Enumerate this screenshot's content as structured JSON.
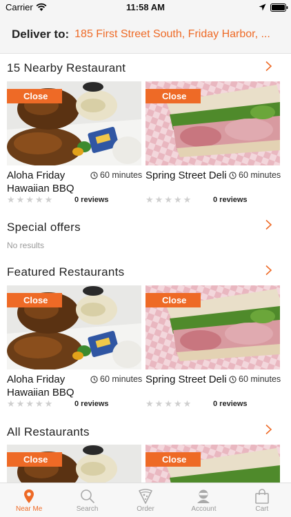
{
  "status_bar": {
    "carrier": "Carrier",
    "time": "11:58 AM"
  },
  "header": {
    "deliver_label": "Deliver to:",
    "address": "185 First Street South, Friday Harbor, ..."
  },
  "sections": {
    "nearby": {
      "title": "15 Nearby Restaurant",
      "cards": [
        {
          "badge": "Close",
          "name": "Aloha Friday Hawaiian BBQ",
          "time": "60 minutes",
          "reviews": "0 reviews"
        },
        {
          "badge": "Close",
          "name": "Spring Street Deli",
          "time": "60 minutes",
          "reviews": "0 reviews"
        }
      ]
    },
    "special": {
      "title": "Special offers",
      "empty_text": "No results"
    },
    "featured": {
      "title": "Featured Restaurants",
      "cards": [
        {
          "badge": "Close",
          "name": "Aloha Friday Hawaiian BBQ",
          "time": "60 minutes",
          "reviews": "0 reviews"
        },
        {
          "badge": "Close",
          "name": "Spring Street Deli",
          "time": "60 minutes",
          "reviews": "0 reviews"
        }
      ]
    },
    "all": {
      "title": "All Restaurants",
      "cards": [
        {
          "badge": "Close"
        },
        {
          "badge": "Close"
        }
      ]
    }
  },
  "tab_bar": {
    "tabs": [
      {
        "label": "Near Me",
        "icon": "location-pin-icon",
        "active": true
      },
      {
        "label": "Search",
        "icon": "search-icon",
        "active": false
      },
      {
        "label": "Order",
        "icon": "pizza-icon",
        "active": false
      },
      {
        "label": "Account",
        "icon": "user-icon",
        "active": false
      },
      {
        "label": "Cart",
        "icon": "shopping-bag-icon",
        "active": false
      }
    ]
  },
  "colors": {
    "accent": "#ee6a26",
    "inactive": "#999999",
    "header_bg": "#f5f5f5"
  }
}
